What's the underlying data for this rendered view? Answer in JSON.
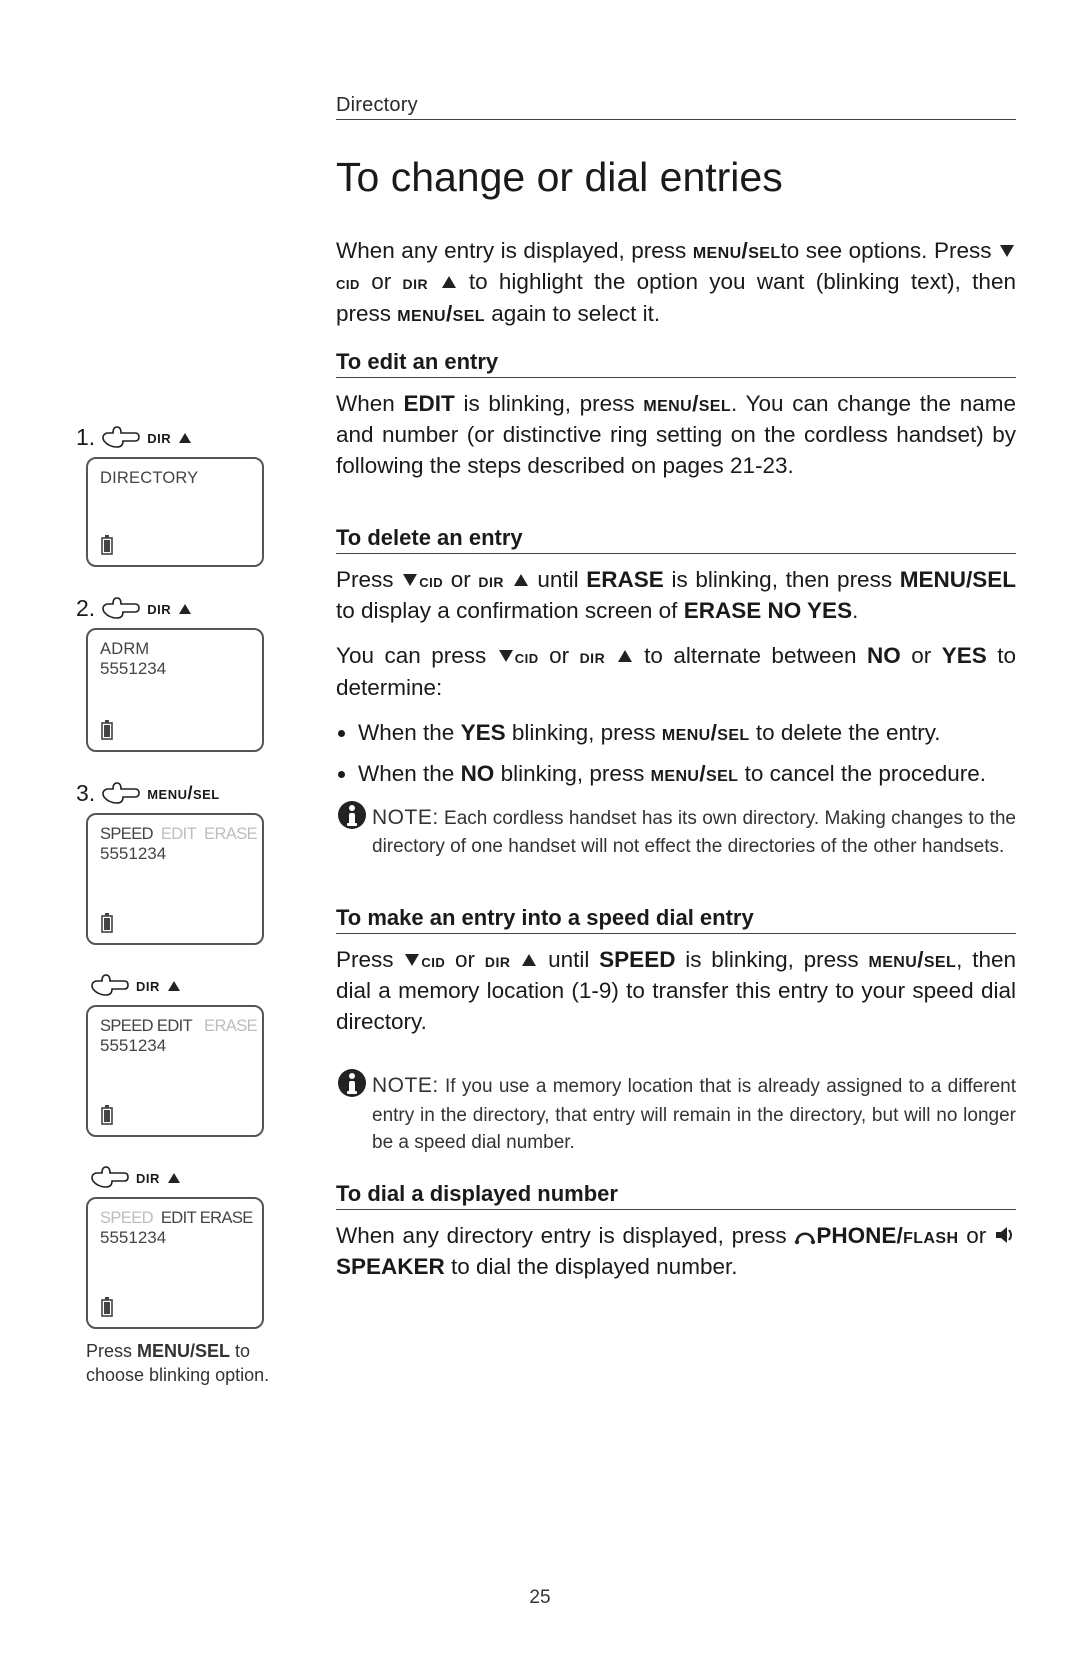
{
  "header": {
    "section": "Directory"
  },
  "title": "To change or dial entries",
  "intro": {
    "p1a": "When any entry is displayed, press ",
    "menusel": "menu/sel",
    "p1b": "to see options. Press ",
    "cid": "cid",
    "p1c": " or ",
    "dir": "dir",
    "p1d": " to highlight the option you want (blinking text), then press ",
    "p1e": " again to select it."
  },
  "edit": {
    "heading": "To edit an entry",
    "p1a": "When ",
    "EDIT": "EDIT",
    "p1b": " is blinking, press ",
    "p1c": ". You can change the name and number (or distinctive ring setting on the cordless handset) by following the steps described on pages 21-23."
  },
  "delete": {
    "heading": "To delete an entry",
    "p1a": "Press ",
    "p1b": " or ",
    "p1c": " until ",
    "ERASE": "ERASE",
    "p1d": " is blinking, then press ",
    "MENUSEL": "MENU/SEL",
    "p1e": " to display a confirmation screen of ",
    "ERASENOYES": "ERASE NO YES",
    "p1f": ".",
    "p2a": "You can press ",
    "p2b": " or ",
    "p2c": " to alternate between ",
    "NO": "NO",
    "p2or": " or ",
    "YES": "YES",
    "p2d": " to determine:",
    "b1a": "When the ",
    "b1b": " blinking, press ",
    "b1c": " to delete the entry.",
    "b2a": "When the ",
    "b2b": " blinking, press ",
    "b2c": " to cancel the procedure.",
    "note_label": "NOTE:",
    "note": " Each cordless handset has its own directory. Making changes to the directory of one handset will not effect the directories of the other handsets."
  },
  "speed": {
    "heading": "To make an entry into a speed dial entry",
    "p1a": "Press ",
    "p1b": " or ",
    "p1c": " until ",
    "SPEED": "SPEED",
    "p1d": " is blinking, press ",
    "p1e": ", then dial a memory location (1-9) to transfer this entry to your speed dial directory.",
    "note_label": "NOTE:",
    "note": " If you use a memory location that is already assigned to a different entry in the directory, that entry will remain in the directory, but will no longer be a speed dial number."
  },
  "dial": {
    "heading": "To dial a displayed number",
    "p1a": "When any directory entry is displayed, press ",
    "PHONE": "PHONE",
    "flash": "/flash",
    "p1or": " or ",
    "SPEAKER": "SPEAKER",
    "p1b": " to dial the displayed number."
  },
  "sidebar": {
    "step1_num": "1.",
    "step2_num": "2.",
    "step3_num": "3.",
    "dir_label": "dir",
    "menusel_label": "menu/sel",
    "lcd1_line1": "DIRECTORY",
    "lcd2_line1": "ADRM",
    "lcd2_line2": "5551234",
    "lcd3_speed": "SPEED",
    "lcd3_edit": "EDIT",
    "lcd3_erase": "ERASE",
    "lcd3_line2": "5551234",
    "lcd4_speededit": "SPEED EDIT",
    "lcd4_erase": "ERASE",
    "lcd4_line2": "5551234",
    "lcd5_speed": "SPEED",
    "lcd5_editerase": "EDIT ERASE",
    "lcd5_line2": "5551234",
    "note_a": "Press ",
    "note_b": "MENU/SEL",
    "note_c": " to choose blinking option."
  },
  "page_number": "25"
}
